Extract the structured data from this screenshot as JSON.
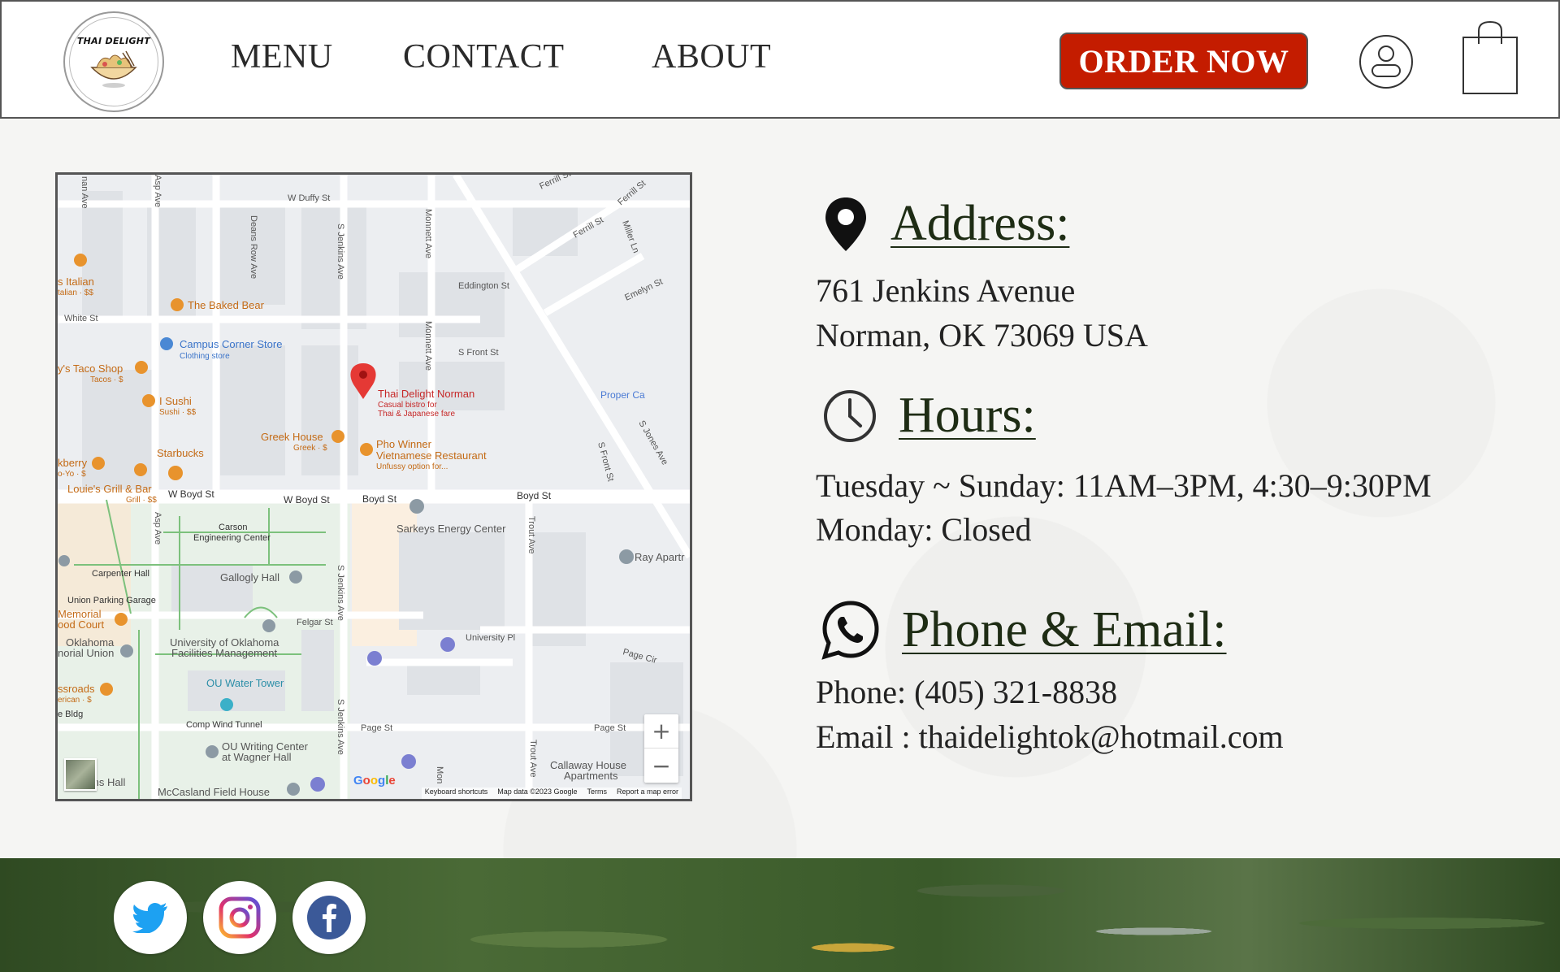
{
  "brand": {
    "logo_text": "THAI DELIGHT"
  },
  "nav": {
    "menu": "MENU",
    "contact": "CONTACT",
    "about": "ABOUT",
    "order": "ORDER NOW"
  },
  "icons": {
    "user": "user-icon",
    "bag": "shopping-bag-icon",
    "location": "map-pin-icon",
    "clock": "clock-icon",
    "phone": "whatsapp-phone-icon",
    "twitter": "twitter-icon",
    "instagram": "instagram-icon",
    "facebook": "facebook-icon"
  },
  "colors": {
    "order_button": "#c41c00",
    "heading": "#1e2c14",
    "map_pin": "#e53935"
  },
  "map": {
    "streets": {
      "duffy": "W Duffy St",
      "ferrill1": "Ferrill St",
      "ferrill2": "Ferrill St",
      "ferrill3": "Ferrill St",
      "miller": "Miller Ln",
      "jenkins1": "S Jenkins Ave",
      "jenkins2": "S Jenkins Ave",
      "jenkins3": "S Jenkins Ave",
      "deans": "Deans Row Ave",
      "monnett1": "Monnett Ave",
      "monnett2": "Monnett Ave",
      "asp1": "Asp Ave",
      "asp2": "Asp Ave",
      "buchanan": "nan Ave",
      "eddington": "Eddington St",
      "emelyn": "Emelyn St",
      "white": "White St",
      "front": "S Front St",
      "front2": "S Front St",
      "jones": "S Jones Ave",
      "boyd1": "W Boyd St",
      "boyd2": "W Boyd St",
      "boyd3": "Boyd St",
      "boyd4": "Boyd St",
      "trout1": "Trout Ave",
      "trout2": "Trout Ave",
      "felgar": "Felgar St",
      "university": "University Pl",
      "pagecir": "Page Cir",
      "page1": "Page St",
      "page2": "Page St"
    },
    "places": {
      "italian": "s Italian",
      "italian_sub": "talian · $$",
      "baked_bear": "The Baked Bear",
      "campus_corner": "Campus Corner Store",
      "campus_corner_sub": "Clothing store",
      "taco": "y's Taco Shop",
      "taco_sub": "Tacos · $",
      "sushi": "I Sushi",
      "sushi_sub": "Sushi · $$",
      "thai": "Thai Delight Norman",
      "thai_sub1": "Casual bistro for",
      "thai_sub2": "Thai & Japanese fare",
      "greek": "Greek House",
      "greek_sub": "Greek · $",
      "pho1": "Pho Winner",
      "pho2": "Vietnamese Restaurant",
      "pho_sub": "Unfussy option for...",
      "starbucks": "Starbucks",
      "kberry": "kberry",
      "kberry_sub": "o-Yo · $",
      "louies": "Louie's Grill & Bar",
      "louies_sub": "Grill · $$",
      "carson1": "Carson",
      "carson2": "Engineering Center",
      "sarkeys": "Sarkeys Energy Center",
      "proper": "Proper Ca",
      "ray": "Ray Apartr",
      "carpenter": "Carpenter Hall",
      "gallogly": "Gallogly Hall",
      "union_parking": "Union Parking Garage",
      "memorial1": "Memorial",
      "memorial2": "ood Court",
      "oklahoma1": "Oklahoma",
      "oklahoma2": "norial Union",
      "uofo1": "University of Oklahoma",
      "uofo2": "Facilities Management",
      "water_tower": "OU Water Tower",
      "crossroads1": "ssroads",
      "crossroads2": "erican · $",
      "bldg": "e Bldg",
      "comp_wind": "Comp Wind Tunnel",
      "writing1": "OU Writing Center",
      "writing2": "at Wagner Hall",
      "callaway1": "Callaway House",
      "callaway2": "Apartments",
      "ms_hall": "ms Hall",
      "mccasland": "McCasland Field House",
      "mon": "Mon"
    },
    "zoom_in": "+",
    "zoom_out": "−",
    "google": "Google",
    "attribution": {
      "shortcuts": "Keyboard shortcuts",
      "data": "Map data ©2023 Google",
      "terms": "Terms",
      "report": "Report a map error"
    }
  },
  "address": {
    "heading": "Address:",
    "line1": "761 Jenkins Avenue",
    "line2": "Norman, OK 73069 USA"
  },
  "hours": {
    "heading": "Hours:",
    "line1": "Tuesday ~ Sunday: 11AM–3PM, 4:30–9:30PM",
    "line2": "Monday: Closed"
  },
  "contact": {
    "heading": "Phone & Email:",
    "phone": "Phone: (405) 321-8838",
    "email": "Email : thaidelightok@hotmail.com"
  }
}
